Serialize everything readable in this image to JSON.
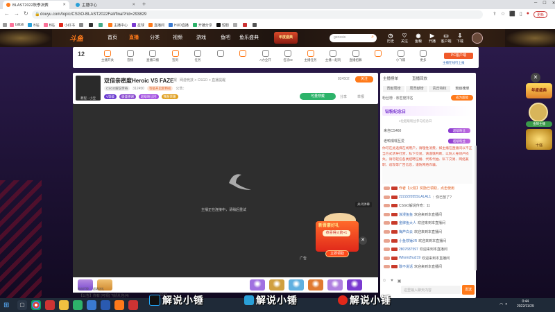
{
  "browser": {
    "tabs": [
      {
        "title": "BLAST2022秋季决赛",
        "active": true
      },
      {
        "title": "主播中心",
        "active": false
      }
    ],
    "url": "douyu.com/topic/CSGO-BLAST2022Fall/final?rid=293829",
    "bookmarks": [
      "bilibili",
      "B站",
      "B站",
      "小红书",
      "",
      "",
      "",
      "主播中心",
      "星球",
      "直播间",
      "HUD直播",
      "开播分享",
      "短剧",
      "",
      "",
      ""
    ],
    "profile_button": "更新"
  },
  "site": {
    "logo": "斗鱼",
    "nav": [
      {
        "label": "首页",
        "active": false
      },
      {
        "label": "直播",
        "active": true
      },
      {
        "label": "分类",
        "active": false
      },
      {
        "label": "视频",
        "active": false
      },
      {
        "label": "游戏",
        "active": false
      },
      {
        "label": "鱼吧",
        "active": false
      },
      {
        "label": "鱼乐盛典",
        "active": false
      }
    ],
    "promo": "年度盛典",
    "search_placeholder": "genesis",
    "icons": [
      "历史",
      "关注",
      "鱼粮",
      "开播",
      "客户端",
      "下载"
    ]
  },
  "toolbar": {
    "level": "12",
    "items": [
      "主播开关",
      "音频",
      "直播口播",
      "签到",
      "任务",
      "",
      "",
      "A力全开",
      "名流ID",
      "主播任务",
      "主播一起玩",
      "直播招募",
      "",
      "小飞碟",
      "更多"
    ],
    "side_button": "PC客户端",
    "side_link": "主播在线行上报"
  },
  "room": {
    "title": "双倍亲密度Heroic VS FAZE",
    "links": [
      "举报",
      "网游竞技 > CSGO > 直播提醒"
    ],
    "tags": [
      "CSGO解说传奇",
      "312450",
      "等级开启新特权"
    ],
    "follow_count": "824502",
    "follow_label": "关注",
    "streamer_label": "教程 - 小宝",
    "badges": [
      "V等级",
      "极盛感谢",
      "超级粉丝团",
      "铁粉荣耀"
    ],
    "notice": "公告：",
    "share": "分享",
    "right_pill": "可量穿戴",
    "report": "举报"
  },
  "video": {
    "caption": "主播正在连接中，请稍后重试",
    "corner_tag": "关闭弹幕",
    "ad_label": "广告",
    "popup": {
      "title": "新晋豪好礼",
      "subtitle": "恭喜得火箭+1",
      "button": "立即领取"
    }
  },
  "giftbar": {
    "left_items": [
      "粉丝打投",
      "超级送礼"
    ],
    "bottom_text": "【公告】你有 [可领] 飞机礼包(4)",
    "count_text": "5015",
    "gifts": [
      "",
      "",
      "",
      "",
      "",
      ""
    ]
  },
  "chat": {
    "top_tabs": [
      "主播榜单",
      "直播回放"
    ],
    "tabs": [
      "贡献周榜",
      "周贡献榜",
      "贵宾特权",
      "粉丝榜单"
    ],
    "rank_banner": "粉丝榜 · 亲密度排名",
    "rank_button": "成为超能",
    "event_title": "钻粉纪念日",
    "event_note": "4位超级粉丝参与纪念日",
    "rank_entries": [
      {
        "name": "来自CS460",
        "badge": "超级粉丝"
      },
      {
        "name": "老鸭嘿嘿互爱",
        "badge": "超级粉丝"
      }
    ],
    "rule_text": "你可在此选择在线用户，请理性消费，如主播在直播间以不正当方式诱导打赏、私下交易，请谨慎判断，以防人身财产损失。请勿轻信各类招聘征婚、代练代抽、私下交易、网络兼职、返现等广告信息，谨防网络诈骗。",
    "messages": [
      {
        "lvl": "",
        "name": "",
        "text": "作者【火箭】奖励已领取，点击使用"
      },
      {
        "lvl": "",
        "name": "222222055SLALAL1",
        "text": "：你已放了?"
      },
      {
        "lvl": "",
        "name": "",
        "text": "CSGO解说传奇：11"
      },
      {
        "lvl": "",
        "name": "浪漫鱼鱼",
        "text": "欢迎来到本直播间"
      },
      {
        "lvl": "",
        "name": "金牌鱼大人",
        "text": "欢迎来到本直播间"
      },
      {
        "lvl": "",
        "name": "梅芦白云",
        "text": "欢迎来到本直播间"
      },
      {
        "lvl": "",
        "name": "小鱼铁锤JR",
        "text": "欢迎来到本直播间"
      },
      {
        "lvl": "",
        "name": "2807687597",
        "text": "欢迎来到本直播间"
      },
      {
        "lvl": "",
        "name": "Whom2hu219",
        "text": "欢迎来到本直播间"
      },
      {
        "lvl": "",
        "name": "敢不说话",
        "text": "欢迎来到本直播间"
      }
    ],
    "input_placeholder": "这里输入聊天内容",
    "send": "发送"
  },
  "right_widgets": [
    "年度盛典",
    "金牌主播",
    "十强"
  ],
  "taskbar": {
    "time": "0:44",
    "date": "2022/11/29"
  },
  "watermarks": [
    {
      "platform": "tiktok",
      "text": "解说小锤"
    },
    {
      "platform": "bilibili",
      "text": "解说小锤"
    },
    {
      "platform": "weibo",
      "text": "解说小锤"
    }
  ],
  "colors": {
    "accent": "#ff7a1a",
    "douyu_orange": "#ff6600",
    "taskbar": "#1f2a38"
  }
}
